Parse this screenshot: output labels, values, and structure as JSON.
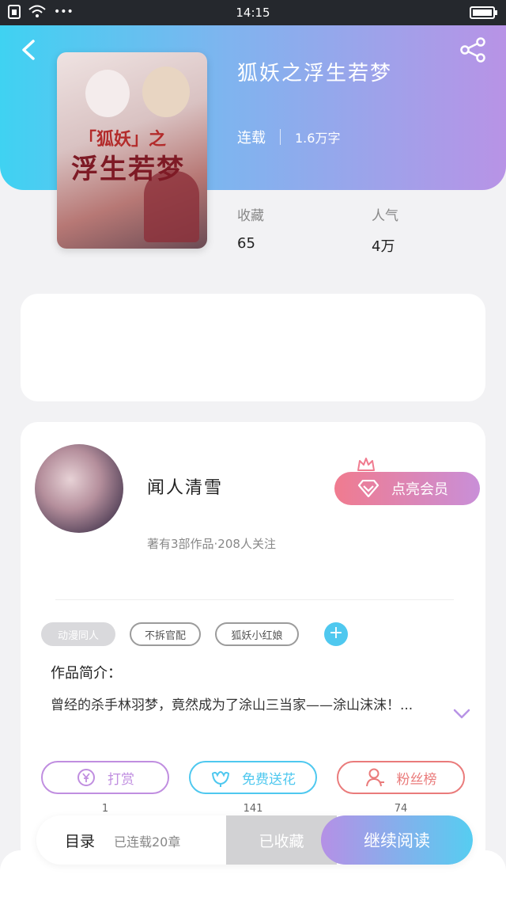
{
  "status_bar": {
    "time": "14:15",
    "more": "•••"
  },
  "book": {
    "title": "狐妖之浮生若梦",
    "cover_text_1": "「狐妖」之",
    "cover_text_2": "浮生若梦",
    "status": "连载",
    "word_count": "1.6万字",
    "stats": [
      {
        "label": "收藏",
        "value": "65"
      },
      {
        "label": "人气",
        "value": "4万"
      }
    ]
  },
  "author": {
    "name": "闻人清雪",
    "subtitle": "著有3部作品·208人关注",
    "vip_label": "点亮会员"
  },
  "tags": [
    "动漫同人",
    "不拆官配",
    "狐妖小红娘"
  ],
  "intro": {
    "title": "作品简介：",
    "text": "曾经的杀手林羽梦，竟然成为了涂山三当家——涂山沫沫！..."
  },
  "actions": [
    {
      "label": "打赏",
      "count": "1",
      "color": "#c08ee0"
    },
    {
      "label": "免费送花",
      "count": "141",
      "color": "#4fc8ef"
    },
    {
      "label": "粉丝榜",
      "count": "74",
      "color": "#ea7b7b"
    }
  ],
  "bottom_bar": {
    "toc_label": "目录",
    "toc_sub": "已连载20章",
    "collected_label": "已收藏",
    "read_label": "继续阅读"
  }
}
